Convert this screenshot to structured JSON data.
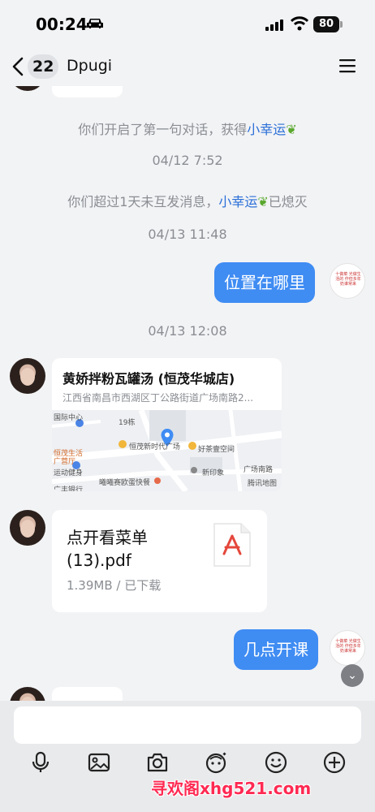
{
  "status_bar": {
    "time": "00:24",
    "battery": "80"
  },
  "nav": {
    "unread_count": "22",
    "title": "Dpugi"
  },
  "messages": {
    "system_1_prefix": "你们开启了第一句对话，获得",
    "system_1_highlight": "小幸运",
    "timestamp_1": "04/12 7:52",
    "system_2_prefix": "你们超过1天未互发消息，",
    "system_2_highlight": "小幸运",
    "system_2_suffix": "已熄灭",
    "timestamp_2": "04/13 11:48",
    "outgoing_1": "位置在哪里",
    "timestamp_3": "04/13 12:08",
    "location": {
      "title": "黄娇拌粉瓦罐汤 (恒茂华城店)",
      "address": "江西省南昌市西湖区丁公路街道广场南路2...",
      "map_labels": [
        "国际中心",
        "19栋",
        "恒茂新时代广场",
        "好茶壹空间",
        "恒茂生活",
        "广营厅",
        "运动健身",
        "新印象",
        "曦曦赛欧蛋快餐",
        "广场南路",
        "广丰银行"
      ],
      "map_attribution": "腾讯地图"
    },
    "file": {
      "name": "点开看菜单(13).pdf",
      "meta": "1.39MB / 已下载"
    },
    "outgoing_2": "几点开课"
  },
  "stickers": {
    "right_avatar_text": "十做菜 光做生活的 作但多年奶谁常来"
  },
  "watermark": "寻欢阁xhg521.com",
  "colors": {
    "accent_blue": "#3f8cf3",
    "highlight_blue": "#2a6fd8",
    "watermark_red": "#ff2a52"
  }
}
